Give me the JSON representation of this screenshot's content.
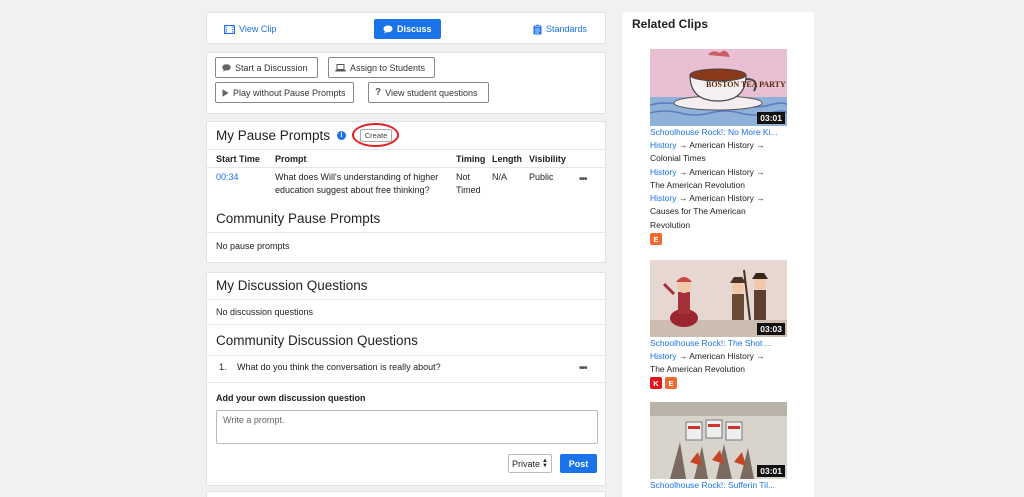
{
  "tabs": {
    "view_clip": "View Clip",
    "discuss": "Discuss",
    "standards": "Standards"
  },
  "actions": {
    "start_discussion": "Start a Discussion",
    "assign_students": "Assign to Students",
    "play_without": "Play without Pause Prompts",
    "view_questions": "View student questions"
  },
  "pause_prompts": {
    "title": "My Pause Prompts",
    "create_label": "Create",
    "columns": [
      "Start Time",
      "Prompt",
      "Timing",
      "Length",
      "Visibility"
    ],
    "rows": [
      {
        "start": "00:34",
        "prompt_line1": "What does Will's understanding of higher",
        "prompt_line2": "education suggest about free thinking?",
        "timing_line1": "Not",
        "timing_line2": "Timed",
        "length": "N/A",
        "visibility": "Public",
        "more": "•••"
      }
    ],
    "community_title": "Community Pause Prompts",
    "community_empty": "No pause prompts"
  },
  "discussion": {
    "title": "My Discussion Questions",
    "empty": "No discussion questions",
    "community_title": "Community Discussion Questions",
    "items": [
      {
        "number": "1.",
        "text": "What do you think the conversation is really about?",
        "more": "•••"
      }
    ],
    "add_label": "Add your own discussion question",
    "placeholder": "Write a prompt.",
    "visibility_value": "Private",
    "post_label": "Post"
  },
  "related": {
    "title": "Related Clips",
    "clips": [
      {
        "duration": "03:01",
        "title": "Schoolhouse Rock!: No More Ki...",
        "thumb_text": "BOSTON TEA PARTY",
        "path_lines": [
          {
            "link": "History",
            "rest": " → American History →"
          },
          {
            "link": "",
            "rest": "Colonial Times"
          },
          {
            "link": "History",
            "rest": " → American History →"
          },
          {
            "link": "",
            "rest": "The American Revolution"
          },
          {
            "link": "History",
            "rest": " → American History →"
          },
          {
            "link": "",
            "rest": "Causes for The American"
          },
          {
            "link": "",
            "rest": "Revolution"
          }
        ],
        "tags": [
          "E"
        ]
      },
      {
        "duration": "03:03",
        "title": "Schoolhouse Rock!: The Shot ...",
        "path_lines": [
          {
            "link": "History",
            "rest": " → American History →"
          },
          {
            "link": "",
            "rest": "The American Revolution"
          }
        ],
        "tags": [
          "K",
          "E"
        ]
      },
      {
        "duration": "03:01",
        "title": "Schoolhouse Rock!: Sufferin Til..."
      }
    ]
  },
  "colors": {
    "accent": "#1a73e8",
    "highlight_ring": "#e31e24",
    "tag_e": "#ee6b2f",
    "tag_k": "#e3151b"
  }
}
